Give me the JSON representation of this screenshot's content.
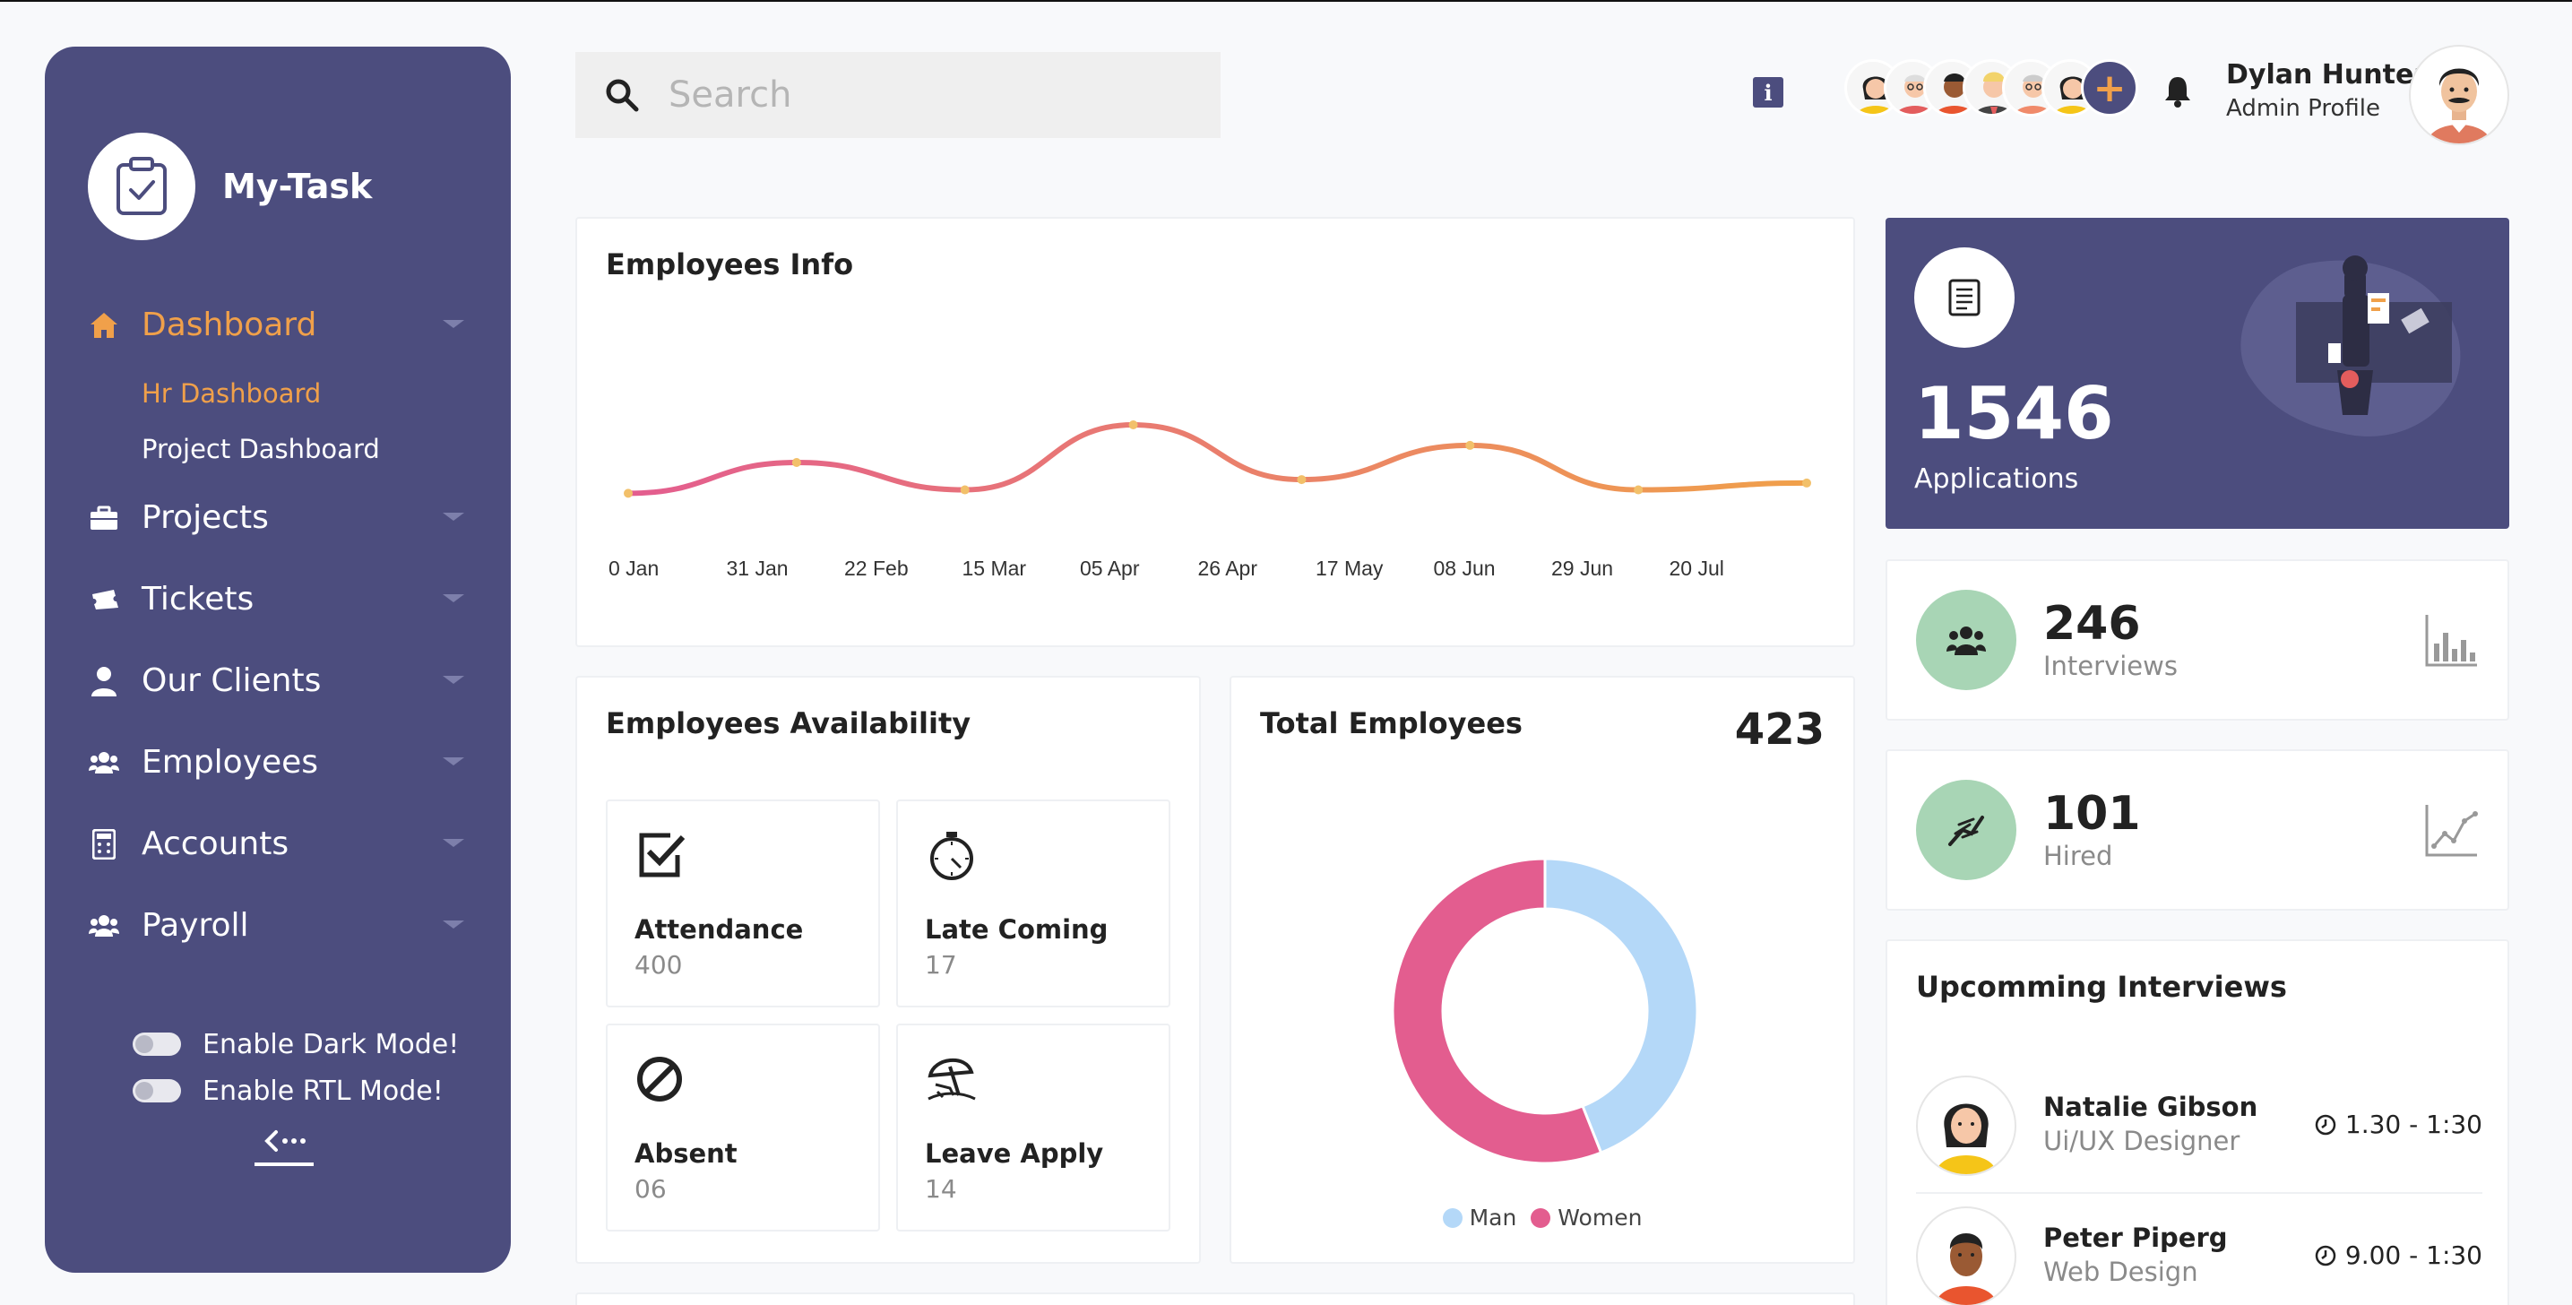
{
  "app": {
    "name": "My-Task"
  },
  "sidebar": {
    "items": [
      {
        "label": "Dashboard",
        "icon": "home-icon",
        "active": true
      },
      {
        "label": "Projects",
        "icon": "briefcase-icon"
      },
      {
        "label": "Tickets",
        "icon": "ticket-icon"
      },
      {
        "label": "Our Clients",
        "icon": "user-icon"
      },
      {
        "label": "Employees",
        "icon": "users-icon"
      },
      {
        "label": "Accounts",
        "icon": "calculator-icon"
      },
      {
        "label": "Payroll",
        "icon": "users-icon"
      }
    ],
    "subitems": [
      {
        "label": "Hr Dashboard",
        "active": true
      },
      {
        "label": "Project Dashboard"
      }
    ],
    "toggles": {
      "dark_mode": "Enable Dark Mode!",
      "rtl_mode": "Enable RTL Mode!"
    }
  },
  "header": {
    "search_placeholder": "Search",
    "user": {
      "name": "Dylan Hunter",
      "role": "Admin Profile"
    },
    "add_label": "+"
  },
  "employees_info": {
    "title": "Employees Info",
    "chart_data": {
      "type": "line",
      "x_tick_labels": [
        "0 Jan",
        "31 Jan",
        "22 Feb",
        "15 Mar",
        "05 Apr",
        "26 Apr",
        "17 May",
        "08 Jun",
        "29 Jun",
        "20 Jul"
      ],
      "series": [
        {
          "values": [
            2,
            11,
            3,
            22,
            6,
            16,
            3,
            5
          ]
        }
      ],
      "colors": [
        "#e35d8f",
        "#f0a04a"
      ]
    }
  },
  "availability": {
    "title": "Employees Availability",
    "tiles": [
      {
        "label": "Attendance",
        "value": "400",
        "icon": "checkbox-icon"
      },
      {
        "label": "Late Coming",
        "value": "17",
        "icon": "stopwatch-icon"
      },
      {
        "label": "Absent",
        "value": "06",
        "icon": "ban-icon"
      },
      {
        "label": "Leave Apply",
        "value": "14",
        "icon": "beach-umbrella-icon"
      }
    ]
  },
  "total_employees": {
    "title": "Total Employees",
    "count": "423",
    "chart_data": {
      "type": "pie",
      "labels": [
        "Man",
        "Women"
      ],
      "values": [
        44,
        56
      ],
      "colors": [
        "#b4d8f8",
        "#e35d8f"
      ]
    }
  },
  "applications": {
    "count": "1546",
    "label": "Applications"
  },
  "stats": [
    {
      "value": "246",
      "label": "Interviews",
      "icon": "group-icon"
    },
    {
      "value": "101",
      "label": "Hired",
      "icon": "handshake-icon"
    }
  ],
  "upcoming": {
    "title": "Upcomming Interviews",
    "items": [
      {
        "name": "Natalie Gibson",
        "role": "Ui/UX Designer",
        "time": "1.30 - 1:30"
      },
      {
        "name": "Peter Piperg",
        "role": "Web Design",
        "time": "9.00 - 1:30"
      }
    ]
  }
}
